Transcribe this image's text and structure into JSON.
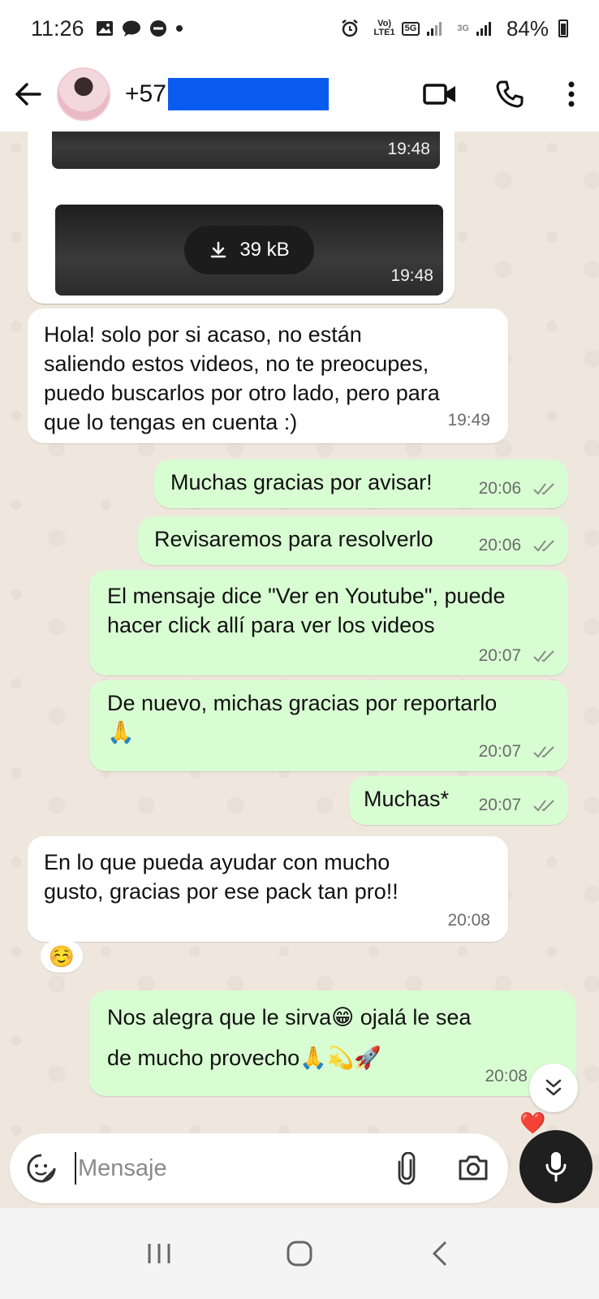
{
  "status_bar": {
    "time": "11:26",
    "volte_label": "Vo)\nLTE1",
    "net_5g": "5G",
    "net_3g": "3G",
    "battery": "84%"
  },
  "header": {
    "phone_prefix": "+57",
    "icons": [
      "back-arrow-icon",
      "video-call-icon",
      "phone-icon",
      "more-vert-icon"
    ]
  },
  "messages": {
    "media1": {
      "time": "19:48"
    },
    "media2": {
      "size": "39 kB",
      "time": "19:48"
    },
    "m1": {
      "text": "Hola! solo por si acaso, no están\nsaliendo estos videos, no te preocupes,\npuedo buscarlos por otro lado, pero para\nque lo tengas en cuenta :)",
      "time": "19:49"
    },
    "m2": {
      "text": "Muchas gracias por avisar!",
      "time": "20:06"
    },
    "m3": {
      "text": "Revisaremos para resolverlo",
      "time": "20:06"
    },
    "m4": {
      "text": "El mensaje dice \"Ver en Youtube\", puede\nhacer click allí para ver los videos",
      "time": "20:07"
    },
    "m5": {
      "text": "De nuevo, michas gracias por reportarlo\n🙏",
      "time": "20:07"
    },
    "m6": {
      "text": "Muchas*",
      "time": "20:07"
    },
    "m7": {
      "text": "En lo que pueda ayudar con mucho\ngusto, gracias por ese pack tan pro!!",
      "time": "20:08",
      "reaction": "☺️"
    },
    "m8": {
      "text": "Nos alegra que le sirva😁 ojalá le sea\nde mucho provecho🙏💫🚀",
      "time": "20:08",
      "reaction": "❤️"
    }
  },
  "composer": {
    "placeholder": "Mensaje"
  },
  "colors": {
    "outgoing_bubble": "#d8fdd2",
    "incoming_bubble": "#ffffff",
    "chat_background": "#efe7dd",
    "redaction": "#0a5cf0"
  }
}
